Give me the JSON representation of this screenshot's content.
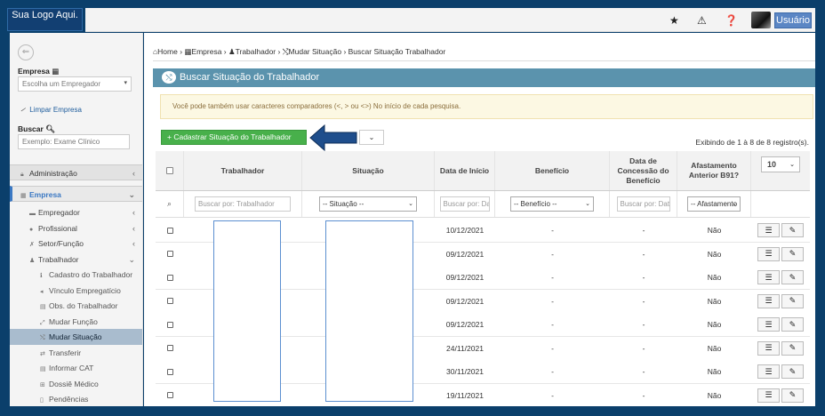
{
  "header": {
    "logo_text": "Sua Logo Aqui.",
    "user_label": "Usuário"
  },
  "sidebar": {
    "empresa_label": "Empresa",
    "empresa_placeholder": "Escolha um Empregador",
    "limpar_label": "Limpar Empresa",
    "buscar_label": "Buscar",
    "buscar_placeholder": "Exemplo: Exame Clínico",
    "menu": {
      "administracao": "Administração",
      "empresa": "Empresa",
      "empregador": "Empregador",
      "profissional": "Profissional",
      "setor_funcao": "Setor/Função",
      "trabalhador": "Trabalhador",
      "cadastro_trabalhador": "Cadastro do Trabalhador",
      "vinculo": "Vínculo Empregatício",
      "obs_trabalhador": "Obs. do Trabalhador",
      "mudar_funcao": "Mudar Função",
      "mudar_situacao": "Mudar Situação",
      "transferir": "Transferir",
      "informar_cat": "Informar CAT",
      "dossie": "Dossiê Médico",
      "pendencias": "Pendências"
    }
  },
  "breadcrumb": {
    "home": "Home",
    "empresa": "Empresa",
    "trabalhador": "Trabalhador",
    "mudar_situacao": "Mudar Situação",
    "current": "Buscar Situação Trabalhador"
  },
  "panel": {
    "title": "Buscar Situação do Trabalhador",
    "info": "Você pode também usar caracteres comparadores (<, > ou <>) No início de cada pesquisa.",
    "add_button": "+ Cadastrar Situação do Trabalhador",
    "exibindo": "Exibindo de 1 à 8 de 8 registro(s)."
  },
  "table": {
    "columns": {
      "trabalhador": "Trabalhador",
      "situacao": "Situação",
      "data_inicio": "Data de Início",
      "beneficio": "Benefício",
      "data_concessao": "Data de Concessão do Benefício",
      "afastamento": "Afastamento Anterior B91?"
    },
    "page_length": "10",
    "filters": {
      "trabalhador_placeholder": "Buscar por: Trabalhador",
      "situacao_value": "-- Situação --",
      "data_inicio_placeholder": "Buscar por: Data",
      "beneficio_value": "-- Benefício --",
      "data_concessao_placeholder": "Buscar por: Data",
      "afastamento_value": "-- Afastamento"
    },
    "rows": [
      {
        "data_inicio": "10/12/2021",
        "beneficio": "-",
        "data_concessao": "-",
        "afastamento": "Não"
      },
      {
        "data_inicio": "09/12/2021",
        "beneficio": "-",
        "data_concessao": "-",
        "afastamento": "Não"
      },
      {
        "data_inicio": "09/12/2021",
        "beneficio": "-",
        "data_concessao": "-",
        "afastamento": "Não"
      },
      {
        "data_inicio": "09/12/2021",
        "beneficio": "-",
        "data_concessao": "-",
        "afastamento": "Não"
      },
      {
        "data_inicio": "09/12/2021",
        "beneficio": "-",
        "data_concessao": "-",
        "afastamento": "Não"
      },
      {
        "data_inicio": "24/11/2021",
        "beneficio": "-",
        "data_concessao": "-",
        "afastamento": "Não"
      },
      {
        "data_inicio": "30/11/2021",
        "beneficio": "-",
        "data_concessao": "-",
        "afastamento": "Não"
      },
      {
        "data_inicio": "19/11/2021",
        "beneficio": "-",
        "data_concessao": "-",
        "afastamento": "Não"
      }
    ]
  },
  "colors": {
    "accent": "#5b93ad",
    "success": "#48b04b",
    "brand": "#123f72"
  }
}
